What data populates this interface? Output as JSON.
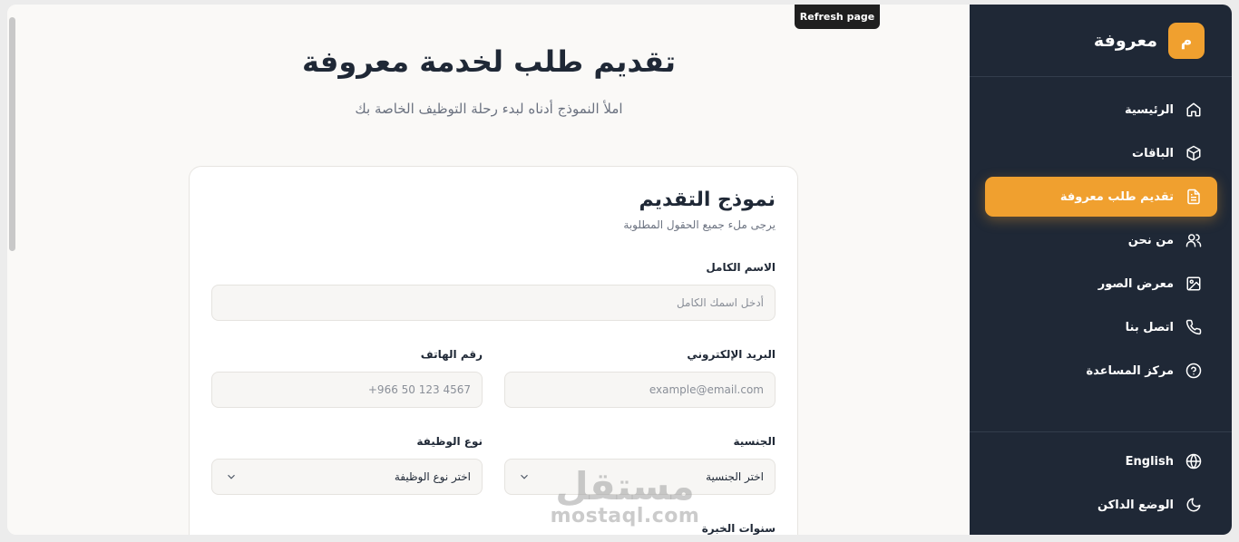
{
  "tooltip": "Refresh page",
  "brand": {
    "badge": "م",
    "name": "معروفة",
    "accent": "#f0a02f",
    "sidebar_bg": "#1f2836"
  },
  "sidebar": {
    "items": [
      {
        "label": "الرئيسية",
        "icon": "home-icon",
        "active": false
      },
      {
        "label": "الباقات",
        "icon": "package-icon",
        "active": false
      },
      {
        "label": "تقديم طلب معروفة",
        "icon": "document-icon",
        "active": true
      },
      {
        "label": "من نحن",
        "icon": "users-icon",
        "active": false
      },
      {
        "label": "معرض الصور",
        "icon": "image-icon",
        "active": false
      },
      {
        "label": "اتصل بنا",
        "icon": "phone-icon",
        "active": false
      },
      {
        "label": "مركز المساعدة",
        "icon": "help-icon",
        "active": false
      }
    ],
    "bottom": [
      {
        "label": "English",
        "icon": "globe-icon"
      },
      {
        "label": "الوضع الداكن",
        "icon": "moon-icon"
      }
    ]
  },
  "page": {
    "title": "تقديم طلب لخدمة معروفة",
    "subtitle": "املأ النموذج أدناه لبدء رحلة التوظيف الخاصة بك"
  },
  "form": {
    "title": "نموذج التقديم",
    "subtitle": "يرجى ملء جميع الحقول المطلوبة",
    "full_name": {
      "label": "الاسم الكامل",
      "placeholder": "أدخل اسمك الكامل"
    },
    "email": {
      "label": "البريد الإلكتروني",
      "placeholder": "example@email.com"
    },
    "phone": {
      "label": "رقم الهاتف",
      "placeholder": "+966 50 123 4567"
    },
    "nationality": {
      "label": "الجنسية",
      "selected": "اختر الجنسية"
    },
    "job_type": {
      "label": "نوع الوظيفة",
      "selected": "اختر نوع الوظيفة"
    },
    "experience": {
      "label": "سنوات الخبرة"
    }
  },
  "watermark": {
    "arabic": "مستقل",
    "latin": "mostaql.com"
  }
}
